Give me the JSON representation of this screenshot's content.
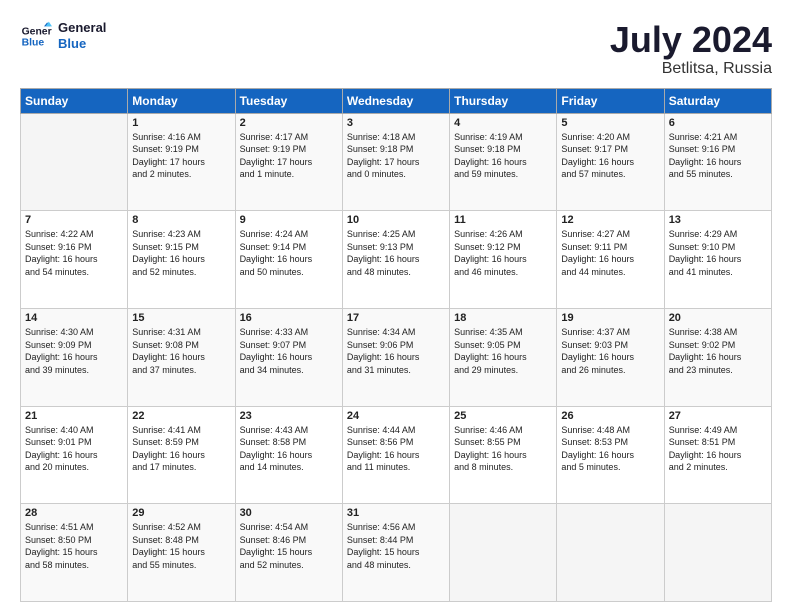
{
  "logo": {
    "line1": "General",
    "line2": "Blue"
  },
  "title": "July 2024",
  "location": "Betlitsa, Russia",
  "days_header": [
    "Sunday",
    "Monday",
    "Tuesday",
    "Wednesday",
    "Thursday",
    "Friday",
    "Saturday"
  ],
  "weeks": [
    [
      {
        "day": "",
        "info": ""
      },
      {
        "day": "1",
        "info": "Sunrise: 4:16 AM\nSunset: 9:19 PM\nDaylight: 17 hours\nand 2 minutes."
      },
      {
        "day": "2",
        "info": "Sunrise: 4:17 AM\nSunset: 9:19 PM\nDaylight: 17 hours\nand 1 minute."
      },
      {
        "day": "3",
        "info": "Sunrise: 4:18 AM\nSunset: 9:18 PM\nDaylight: 17 hours\nand 0 minutes."
      },
      {
        "day": "4",
        "info": "Sunrise: 4:19 AM\nSunset: 9:18 PM\nDaylight: 16 hours\nand 59 minutes."
      },
      {
        "day": "5",
        "info": "Sunrise: 4:20 AM\nSunset: 9:17 PM\nDaylight: 16 hours\nand 57 minutes."
      },
      {
        "day": "6",
        "info": "Sunrise: 4:21 AM\nSunset: 9:16 PM\nDaylight: 16 hours\nand 55 minutes."
      }
    ],
    [
      {
        "day": "7",
        "info": "Sunrise: 4:22 AM\nSunset: 9:16 PM\nDaylight: 16 hours\nand 54 minutes."
      },
      {
        "day": "8",
        "info": "Sunrise: 4:23 AM\nSunset: 9:15 PM\nDaylight: 16 hours\nand 52 minutes."
      },
      {
        "day": "9",
        "info": "Sunrise: 4:24 AM\nSunset: 9:14 PM\nDaylight: 16 hours\nand 50 minutes."
      },
      {
        "day": "10",
        "info": "Sunrise: 4:25 AM\nSunset: 9:13 PM\nDaylight: 16 hours\nand 48 minutes."
      },
      {
        "day": "11",
        "info": "Sunrise: 4:26 AM\nSunset: 9:12 PM\nDaylight: 16 hours\nand 46 minutes."
      },
      {
        "day": "12",
        "info": "Sunrise: 4:27 AM\nSunset: 9:11 PM\nDaylight: 16 hours\nand 44 minutes."
      },
      {
        "day": "13",
        "info": "Sunrise: 4:29 AM\nSunset: 9:10 PM\nDaylight: 16 hours\nand 41 minutes."
      }
    ],
    [
      {
        "day": "14",
        "info": "Sunrise: 4:30 AM\nSunset: 9:09 PM\nDaylight: 16 hours\nand 39 minutes."
      },
      {
        "day": "15",
        "info": "Sunrise: 4:31 AM\nSunset: 9:08 PM\nDaylight: 16 hours\nand 37 minutes."
      },
      {
        "day": "16",
        "info": "Sunrise: 4:33 AM\nSunset: 9:07 PM\nDaylight: 16 hours\nand 34 minutes."
      },
      {
        "day": "17",
        "info": "Sunrise: 4:34 AM\nSunset: 9:06 PM\nDaylight: 16 hours\nand 31 minutes."
      },
      {
        "day": "18",
        "info": "Sunrise: 4:35 AM\nSunset: 9:05 PM\nDaylight: 16 hours\nand 29 minutes."
      },
      {
        "day": "19",
        "info": "Sunrise: 4:37 AM\nSunset: 9:03 PM\nDaylight: 16 hours\nand 26 minutes."
      },
      {
        "day": "20",
        "info": "Sunrise: 4:38 AM\nSunset: 9:02 PM\nDaylight: 16 hours\nand 23 minutes."
      }
    ],
    [
      {
        "day": "21",
        "info": "Sunrise: 4:40 AM\nSunset: 9:01 PM\nDaylight: 16 hours\nand 20 minutes."
      },
      {
        "day": "22",
        "info": "Sunrise: 4:41 AM\nSunset: 8:59 PM\nDaylight: 16 hours\nand 17 minutes."
      },
      {
        "day": "23",
        "info": "Sunrise: 4:43 AM\nSunset: 8:58 PM\nDaylight: 16 hours\nand 14 minutes."
      },
      {
        "day": "24",
        "info": "Sunrise: 4:44 AM\nSunset: 8:56 PM\nDaylight: 16 hours\nand 11 minutes."
      },
      {
        "day": "25",
        "info": "Sunrise: 4:46 AM\nSunset: 8:55 PM\nDaylight: 16 hours\nand 8 minutes."
      },
      {
        "day": "26",
        "info": "Sunrise: 4:48 AM\nSunset: 8:53 PM\nDaylight: 16 hours\nand 5 minutes."
      },
      {
        "day": "27",
        "info": "Sunrise: 4:49 AM\nSunset: 8:51 PM\nDaylight: 16 hours\nand 2 minutes."
      }
    ],
    [
      {
        "day": "28",
        "info": "Sunrise: 4:51 AM\nSunset: 8:50 PM\nDaylight: 15 hours\nand 58 minutes."
      },
      {
        "day": "29",
        "info": "Sunrise: 4:52 AM\nSunset: 8:48 PM\nDaylight: 15 hours\nand 55 minutes."
      },
      {
        "day": "30",
        "info": "Sunrise: 4:54 AM\nSunset: 8:46 PM\nDaylight: 15 hours\nand 52 minutes."
      },
      {
        "day": "31",
        "info": "Sunrise: 4:56 AM\nSunset: 8:44 PM\nDaylight: 15 hours\nand 48 minutes."
      },
      {
        "day": "",
        "info": ""
      },
      {
        "day": "",
        "info": ""
      },
      {
        "day": "",
        "info": ""
      }
    ]
  ]
}
